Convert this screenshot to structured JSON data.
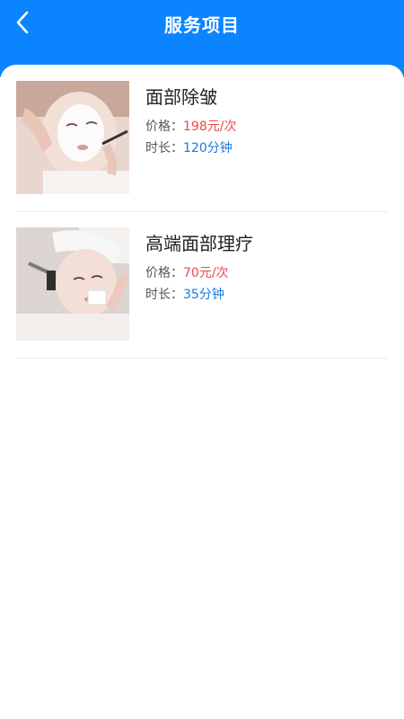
{
  "header": {
    "title": "服务项目",
    "back_icon": "chevron-left-icon",
    "background": "#0a84ff"
  },
  "services": [
    {
      "name": "面部除皱",
      "price_label": "价格：",
      "price": "198元/次",
      "duration_label": "时长：",
      "duration": "120分钟"
    },
    {
      "name": "高端面部理疗",
      "price_label": "价格：",
      "price": "70元/次",
      "duration_label": "时长：",
      "duration": "35分钟"
    }
  ],
  "colors": {
    "accent": "#0a84ff",
    "price": "#ea4b4b",
    "duration": "#1f78e0"
  }
}
